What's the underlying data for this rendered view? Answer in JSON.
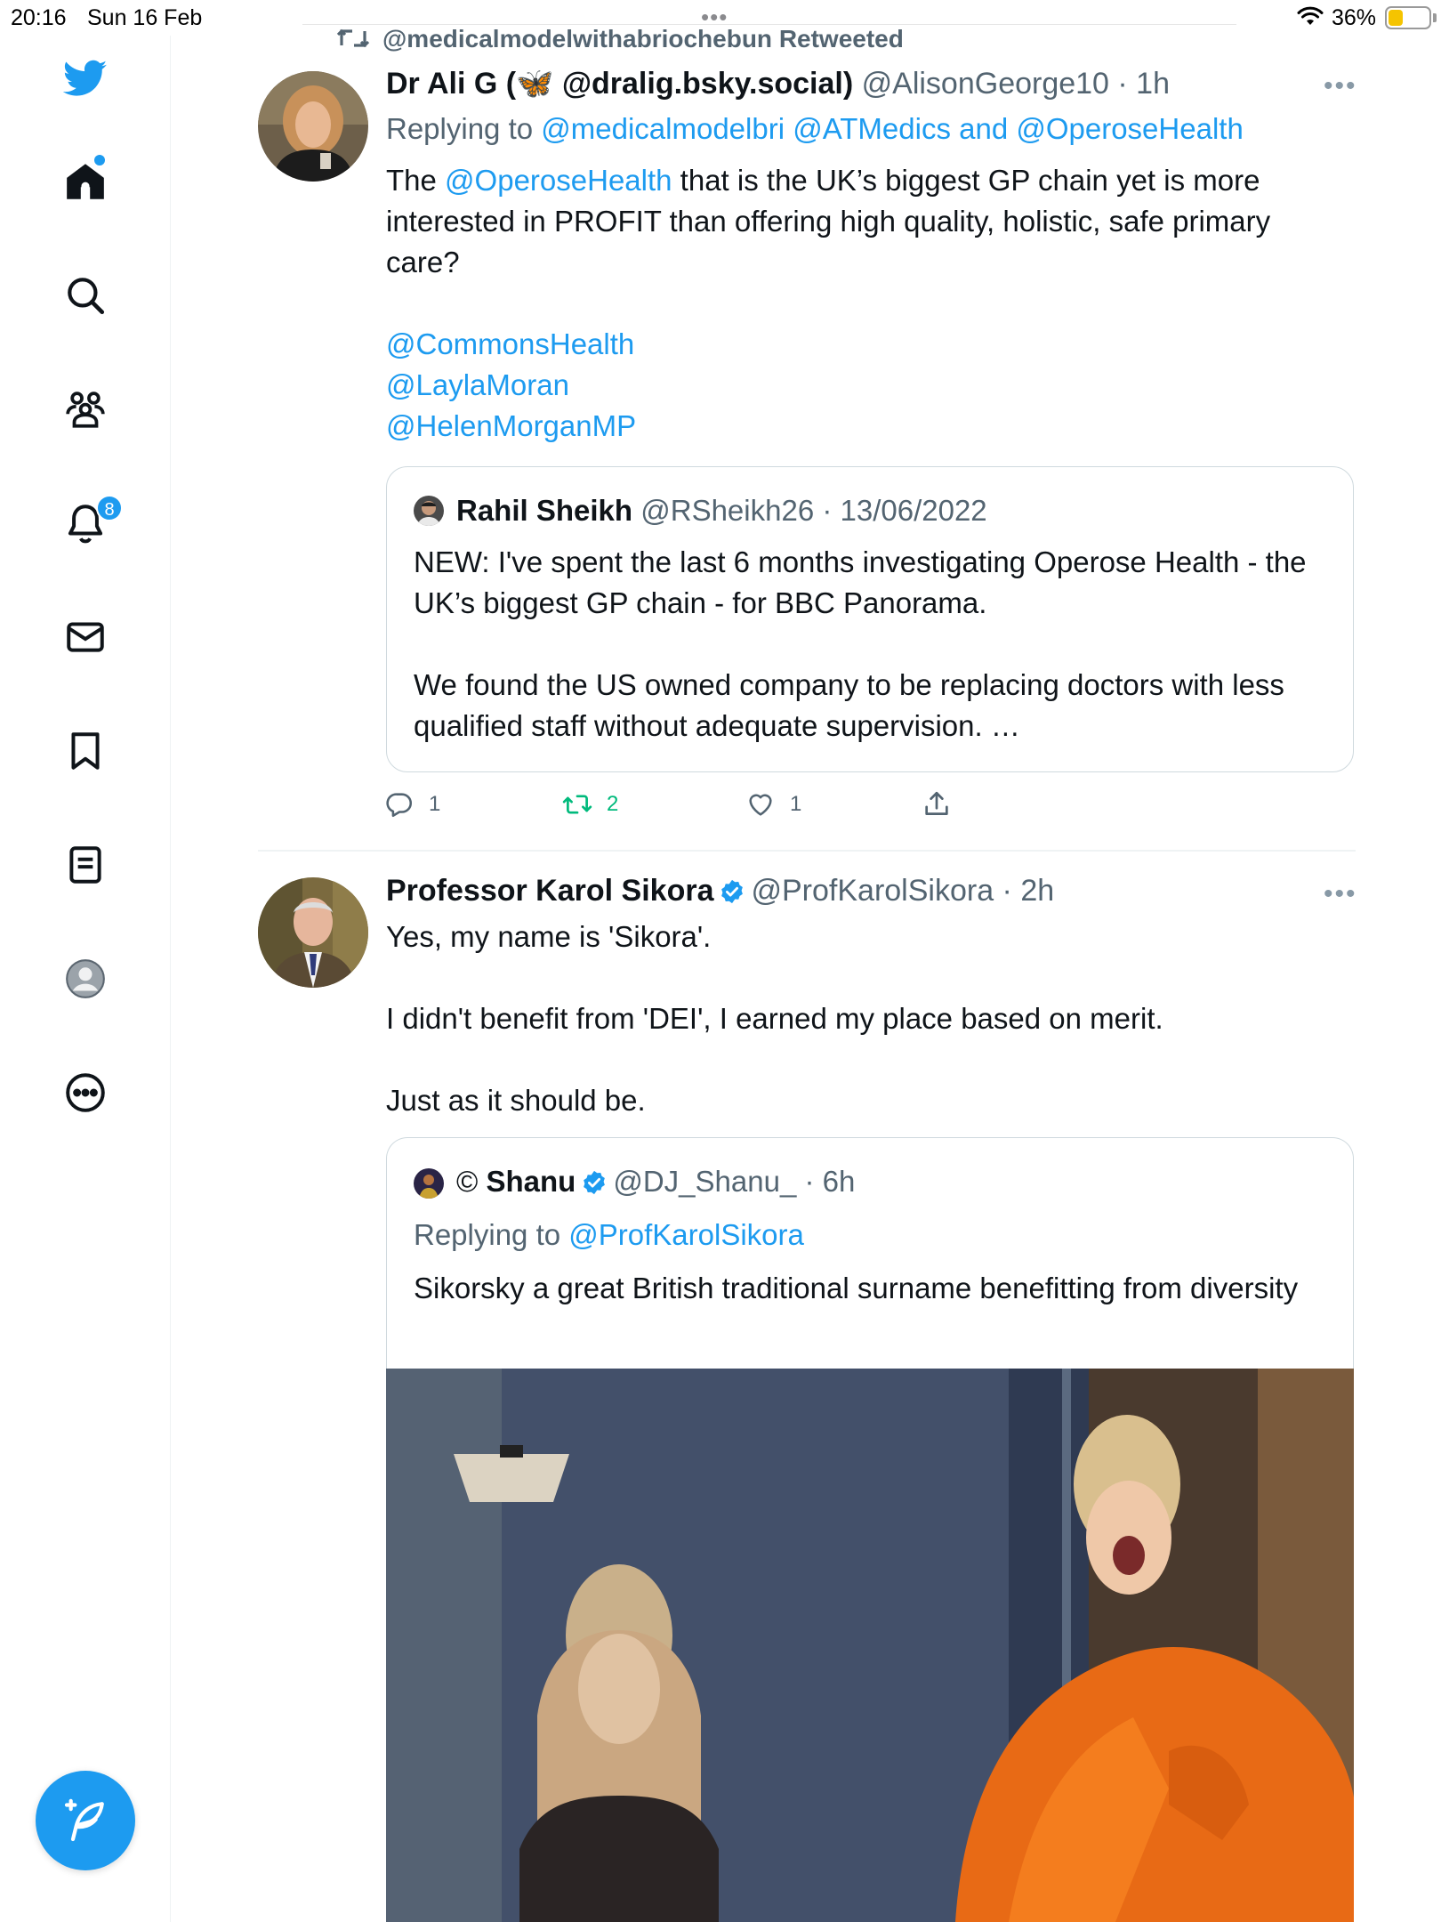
{
  "status_bar": {
    "time": "20:16",
    "date": "Sun 16 Feb",
    "battery": "36%",
    "battery_level": 0.36,
    "multitask": "•••"
  },
  "sidebar": {
    "items": [
      {
        "name": "twitter-logo-icon"
      },
      {
        "name": "home-icon"
      },
      {
        "name": "search-icon"
      },
      {
        "name": "communities-icon"
      },
      {
        "name": "notifications-icon",
        "badge": "8"
      },
      {
        "name": "messages-icon"
      },
      {
        "name": "bookmarks-icon"
      },
      {
        "name": "lists-icon"
      },
      {
        "name": "profile-icon"
      },
      {
        "name": "more-icon"
      }
    ],
    "compose_icon": "compose-icon"
  },
  "colors": {
    "accent": "#1d9bf0",
    "retweet": "#00ba7c",
    "muted": "#536471"
  },
  "retweet_context": "@medicalmodelwithabriochebun Retweeted",
  "tweet1": {
    "name": "Dr Ali G (🦋 @dralig.bsky.social)",
    "meta": "@AlisonGeorge10 · 1h",
    "replying_prefix": "Replying to ",
    "replying_to": "@medicalmodelbri @ATMedics and @OperoseHealth",
    "text_pre": "The ",
    "text_mention": "@OperoseHealth",
    "text_post": " that is the UK’s biggest GP chain yet is more interested in PROFIT than offering high quality, holistic, safe primary care?",
    "mentions": [
      "@CommonsHealth",
      "@LaylaMoran",
      "@HelenMorganMP"
    ],
    "quote": {
      "name": "Rahil Sheikh",
      "meta": "@RSheikh26 · 13/06/2022",
      "text1": "NEW: I've spent the last 6 months investigating Operose Health - the UK’s biggest GP chain -  for BBC Panorama.",
      "text2": "We found the US owned company to be replacing doctors with less qualified staff without adequate supervision. …"
    },
    "actions": {
      "reply_count": "1",
      "retweet_count": "2",
      "like_count": "1"
    }
  },
  "tweet2": {
    "name": "Professor Karol Sikora",
    "meta": "@ProfKarolSikora · 2h",
    "line1": "Yes, my name is 'Sikora'.",
    "line2": "I didn't benefit from 'DEI', I earned my place based on merit.",
    "line3": "Just as it should be.",
    "quote": {
      "prefix": "©",
      "name": "Shanu",
      "meta": "@DJ_Shanu_ · 6h",
      "replying_prefix": "Replying to ",
      "replying_to": "@ProfKarolSikora",
      "text": "Sikorsky a great British traditional surname benefitting from diversity"
    }
  }
}
